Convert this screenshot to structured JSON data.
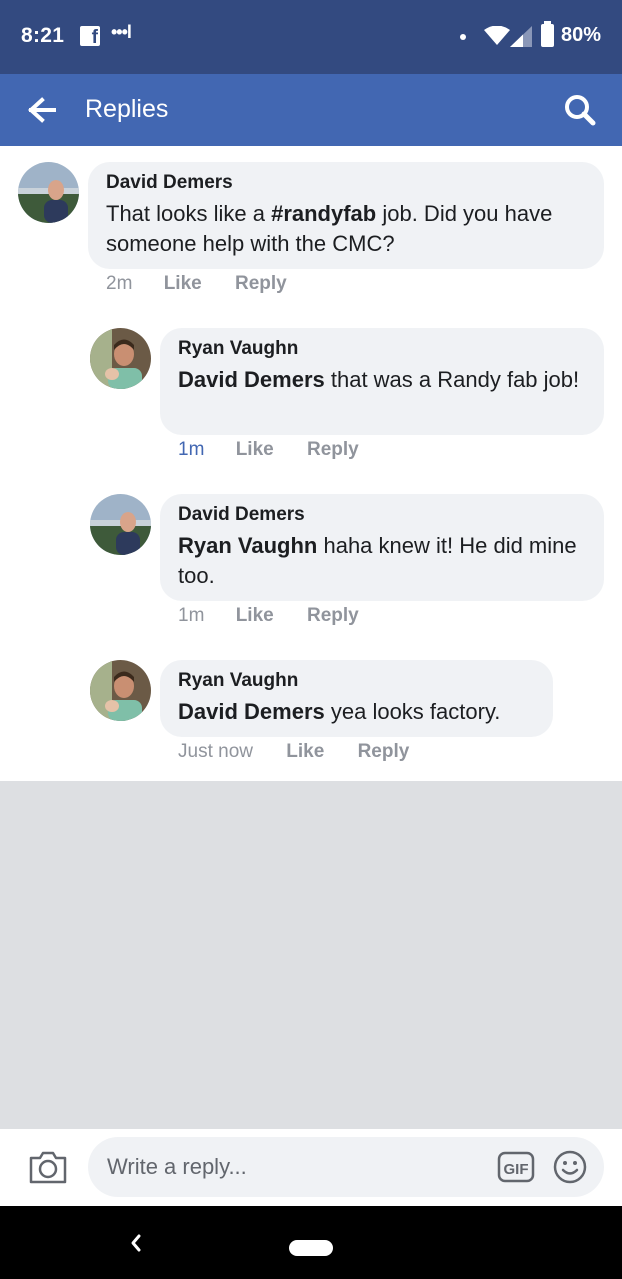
{
  "status_bar": {
    "time": "8:21",
    "app_icon": "facebook-icon",
    "dots": "•••l",
    "battery": "80%"
  },
  "header": {
    "title": "Replies",
    "back_icon": "arrow-left-icon",
    "search_icon": "search-icon"
  },
  "comments": [
    {
      "author": "David Demers",
      "text_before": "That looks like a ",
      "hashtag": "#randyfab",
      "text_after": " job.  Did you have someone help with the CMC?",
      "time": "2m",
      "like": "Like",
      "reply": "Reply"
    },
    {
      "author": "Ryan Vaughn",
      "mention": "David Demers",
      "text": "  that was a Randy fab job!",
      "time": "1m",
      "like": "Like",
      "reply": "Reply"
    },
    {
      "author": "David Demers",
      "mention": "Ryan Vaughn",
      "text": " haha knew it! He did mine too.",
      "time": "1m",
      "like": "Like",
      "reply": "Reply"
    },
    {
      "author": "Ryan Vaughn",
      "mention": "David Demers",
      "text": "  yea looks factory.",
      "time": "Just now",
      "like": "Like",
      "reply": "Reply"
    }
  ],
  "composer": {
    "placeholder": "Write a reply...",
    "camera_icon": "camera-icon",
    "gif_label": "GIF",
    "emoji_icon": "smiley-icon"
  },
  "colors": {
    "status_bar": "#334a80",
    "app_bar": "#4267b2",
    "bubble": "#f0f2f5",
    "highlight_time": "#4267b2",
    "meta_text": "#90949c"
  }
}
